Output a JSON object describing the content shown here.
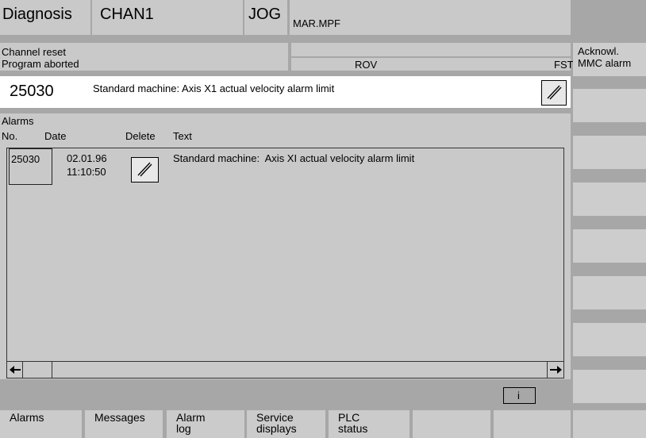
{
  "header": {
    "area": "Diagnosis",
    "channel": "CHAN1",
    "mode": "JOG",
    "program": "MAR.MPF"
  },
  "status": {
    "line1": "Channel reset",
    "line2": "Program aborted",
    "rov": "ROV",
    "fst": "FST"
  },
  "alarm_line": {
    "number": "25030",
    "text": "Standard machine: Axis X1 actual velocity alarm limit"
  },
  "alarm_list": {
    "title": "Alarms",
    "columns": [
      "No.",
      "Date",
      "Delete",
      "Text"
    ],
    "rows": [
      {
        "no": "25030",
        "date": "02.01.96",
        "time": "11:10:50",
        "text": "Standard machine:  Axis XI actual velocity alarm limit"
      }
    ]
  },
  "right_softkeys": {
    "acknowl_line1": "Acknowl.",
    "acknowl_line2": "MMC alarm"
  },
  "info_button": "i",
  "bottom_softkeys": [
    {
      "line1": "Alarms",
      "line2": ""
    },
    {
      "line1": "Messages",
      "line2": ""
    },
    {
      "line1": "Alarm",
      "line2": "log"
    },
    {
      "line1": "Service",
      "line2": "displays"
    },
    {
      "line1": "PLC",
      "line2": "status"
    },
    {
      "line1": "",
      "line2": ""
    },
    {
      "line1": "",
      "line2": ""
    }
  ],
  "icons": {
    "delete_alarm": "cancel-slash-icon",
    "scroll_left": "arrow-left-icon",
    "scroll_right": "arrow-right-icon"
  }
}
